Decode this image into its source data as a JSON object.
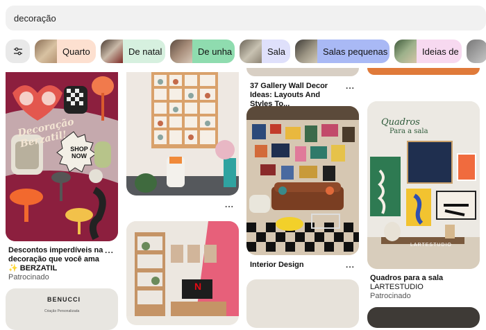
{
  "search": {
    "query": "decoração"
  },
  "chips": [
    {
      "label": "Quarto",
      "color": "#fde0d0"
    },
    {
      "label": "De natal",
      "color": "#d6f0df"
    },
    {
      "label": "De unha",
      "color": "#8fdcaf"
    },
    {
      "label": "Sala",
      "color": "#dfe0fb"
    },
    {
      "label": "Salas pequenas",
      "color": "#a9b9f5"
    },
    {
      "label": "Ideias de",
      "color": "#f7d9f0"
    }
  ],
  "pins": {
    "col1_top": {
      "poster_title": "Decoração Berzatil!",
      "badge": "SHOP NOW",
      "caption": "Descontos imperdíveis na decoração que você ama ✨ BERZATIL",
      "sponsored": "Patrocinado"
    },
    "col1_bottom": {
      "sign_text": "BENUCCI",
      "sign_sub": "Criação Personalizada"
    },
    "col2_bottom": {
      "tv_logo": "N"
    },
    "col3_top": {
      "caption": "37 Gallery Wall Decor Ideas: Layouts And Styles To..."
    },
    "col3_mid": {
      "caption": "Interior Design"
    },
    "col4_mid": {
      "poster_title": "Quadros",
      "poster_sub": "Para a sala",
      "studio_mark": "LARTESTUDIO",
      "caption": "Quadros para a sala",
      "sub": "LARTESTUDIO",
      "sponsored": "Patrocinado"
    }
  },
  "more": "..."
}
